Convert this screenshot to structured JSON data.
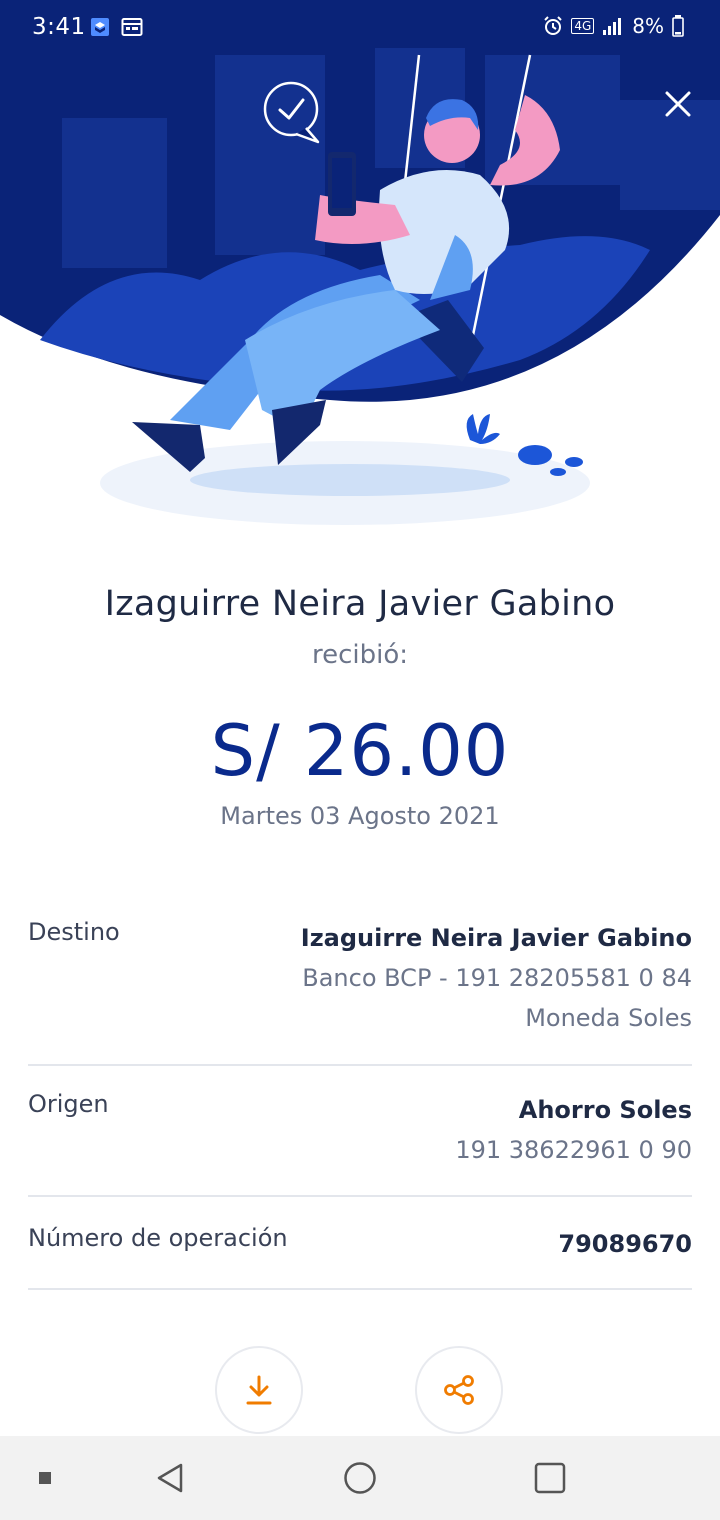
{
  "status_bar": {
    "time": "3:41",
    "network_badge": "4G",
    "battery": "8%"
  },
  "receipt": {
    "recipient_name": "Izaguirre Neira Javier Gabino",
    "received_label": "recibió:",
    "amount": "S/ 26.00",
    "date": "Martes 03 Agosto 2021"
  },
  "details": {
    "destination": {
      "label": "Destino",
      "name": "Izaguirre Neira Javier Gabino",
      "bank_account": "Banco BCP - 191 28205581 0 84",
      "currency": "Moneda Soles"
    },
    "origin": {
      "label": "Origen",
      "account_type": "Ahorro Soles",
      "account_number": "191 38622961 0 90"
    },
    "operation": {
      "label": "Número de operación",
      "number": "79089670"
    }
  },
  "actions": [
    {
      "icon": "download-icon"
    },
    {
      "icon": "share-icon"
    }
  ],
  "colors": {
    "brand_blue": "#0a2a8c",
    "accent_orange": "#f07c00",
    "hero_dark": "#0a2378"
  }
}
